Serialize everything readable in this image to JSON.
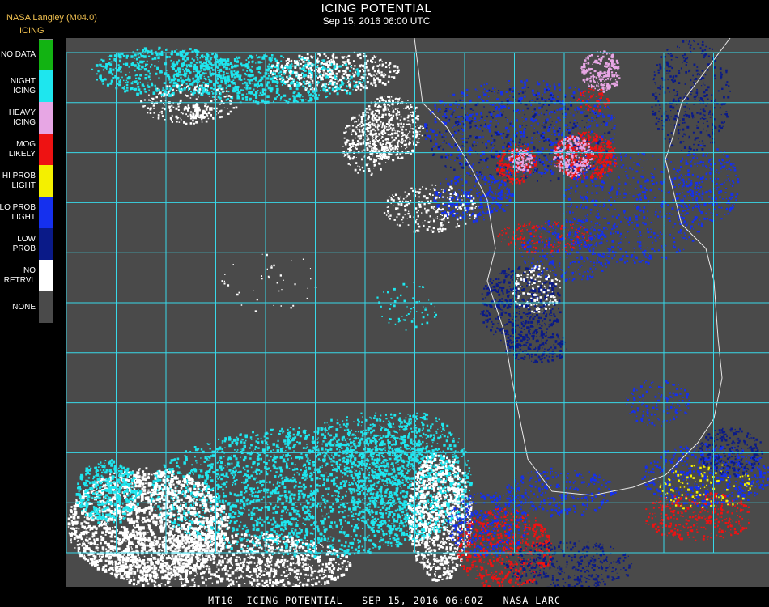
{
  "header": {
    "source": "NASA Langley (M04.0)",
    "title": "ICING POTENTIAL",
    "datetime": "Sep 15, 2016 06:00 UTC"
  },
  "legend": {
    "title": "ICING",
    "items": [
      {
        "label": "NO DATA",
        "color": "#12b312"
      },
      {
        "label": "NIGHT\nICING",
        "color": "#1ee6ee"
      },
      {
        "label": "HEAVY\nICING",
        "color": "#e7a6e4"
      },
      {
        "label": "MOG\nLIKELY",
        "color": "#ee1212"
      },
      {
        "label": "HI PROB\nLIGHT",
        "color": "#f4f000"
      },
      {
        "label": "LO PROB\nLIGHT",
        "color": "#1530ee"
      },
      {
        "label": "LOW\nPROB",
        "color": "#0a1a88"
      },
      {
        "label": "NO\nRETRVL",
        "color": "#ffffff"
      },
      {
        "label": "NONE",
        "color": "#4a4a4a"
      }
    ]
  },
  "map": {
    "background_color": "#4a4a4a",
    "grid_color": "#38d8e8",
    "label_color": "#d82020",
    "coast_color": "#e8e8e8"
  },
  "footer": {
    "text": "MT10  ICING POTENTIAL   SEP 15, 2016 06:00Z   NASA LARC"
  }
}
